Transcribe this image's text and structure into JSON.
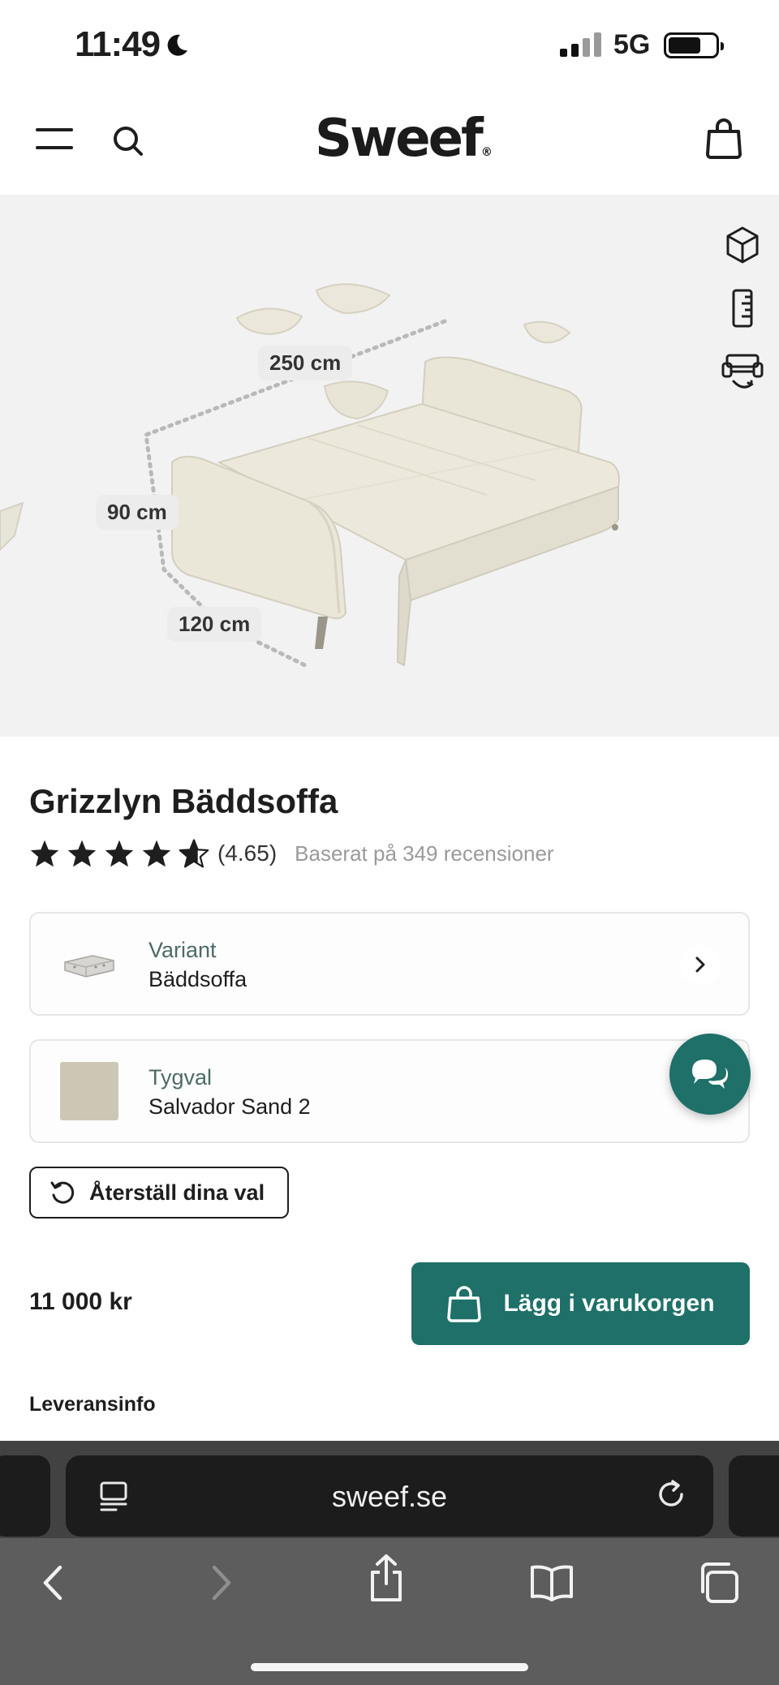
{
  "status_bar": {
    "time": "11:49",
    "network": "5G",
    "battery_level": 0.7
  },
  "header": {
    "logo": "Sweef",
    "logo_mark": "®"
  },
  "product_image": {
    "dimensions": [
      "250 cm",
      "90 cm",
      "120 cm"
    ]
  },
  "product": {
    "title": "Grizzlyn Bäddsoffa",
    "rating_value": "(4.65)",
    "rating_stars": 4.65,
    "rating_text": "Baserat på 349 recensioner"
  },
  "options": [
    {
      "label": "Variant",
      "value": "Bäddsoffa"
    },
    {
      "label": "Tygval",
      "value": "Salvador Sand 2"
    }
  ],
  "reset_label": "Återställ dina val",
  "price": "11 000 kr",
  "add_to_cart_label": "Lägg i varukorgen",
  "delivery_info_label": "Leveransinfo",
  "browser": {
    "url": "sweef.se"
  },
  "colors": {
    "accent": "#1e7068",
    "image_bg": "#f2f2f2",
    "fabric": "#ece9dc"
  },
  "icons": [
    "moon-icon",
    "menu-icon",
    "search-icon",
    "cart-icon",
    "3d-cube-icon",
    "ruler-icon",
    "sofa-bed-icon",
    "star-icon",
    "chevron-right-icon",
    "chat-icon",
    "reset-icon",
    "bag-icon",
    "reader-icon",
    "reload-icon",
    "back-icon",
    "forward-icon",
    "share-icon",
    "bookmarks-icon",
    "tabs-icon"
  ]
}
